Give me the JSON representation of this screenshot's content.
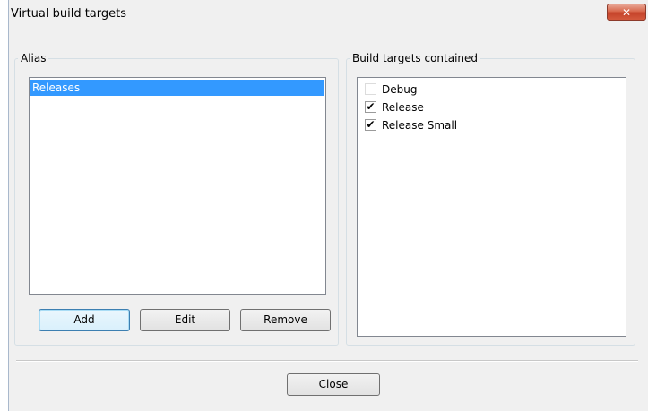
{
  "window": {
    "title": "Virtual build targets",
    "close_glyph": "✕"
  },
  "alias_group": {
    "legend": "Alias",
    "items": [
      {
        "label": "Releases",
        "selected": true
      }
    ],
    "buttons": {
      "add": "Add",
      "edit": "Edit",
      "remove": "Remove"
    }
  },
  "targets_group": {
    "legend": "Build targets contained",
    "items": [
      {
        "label": "Debug",
        "checked": false
      },
      {
        "label": "Release",
        "checked": true
      },
      {
        "label": "Release Small",
        "checked": true
      }
    ]
  },
  "footer": {
    "close_label": "Close"
  },
  "colors": {
    "selection": "#3399ff",
    "dialog_bg": "#f0f0f0",
    "close_button": "#c5432a"
  }
}
